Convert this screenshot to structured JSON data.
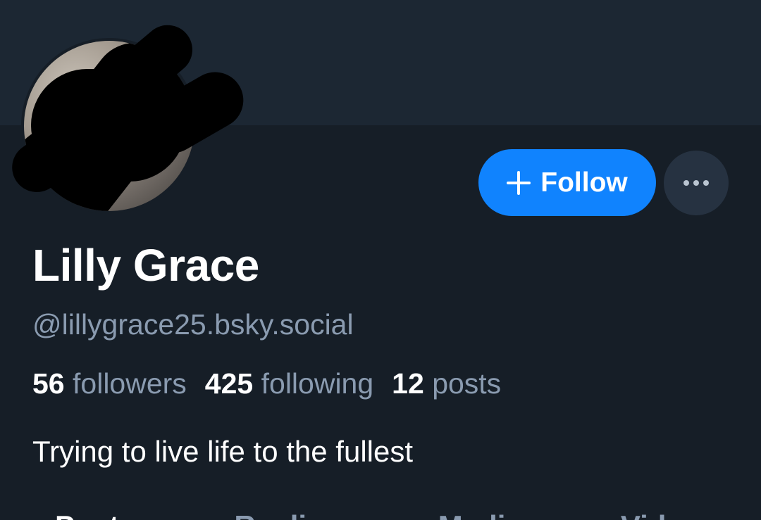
{
  "profile": {
    "display_name": "Lilly Grace",
    "handle": "@lillygrace25.bsky.social",
    "bio": "Trying to live life to the fullest",
    "avatar_icon": "user-avatar"
  },
  "stats": {
    "followers_count": "56",
    "followers_label": "followers",
    "following_count": "425",
    "following_label": "following",
    "posts_count": "12",
    "posts_label": "posts"
  },
  "actions": {
    "follow_label": "Follow",
    "follow_icon": "plus-icon",
    "more_icon": "ellipsis-icon"
  },
  "tabs": [
    {
      "label": "Posts"
    },
    {
      "label": "Replies"
    },
    {
      "label": "Media"
    },
    {
      "label": "Videos"
    }
  ],
  "colors": {
    "background": "#161e27",
    "banner": "#1c2733",
    "accent": "#1083fe",
    "secondary_text": "#8a9bb0"
  }
}
